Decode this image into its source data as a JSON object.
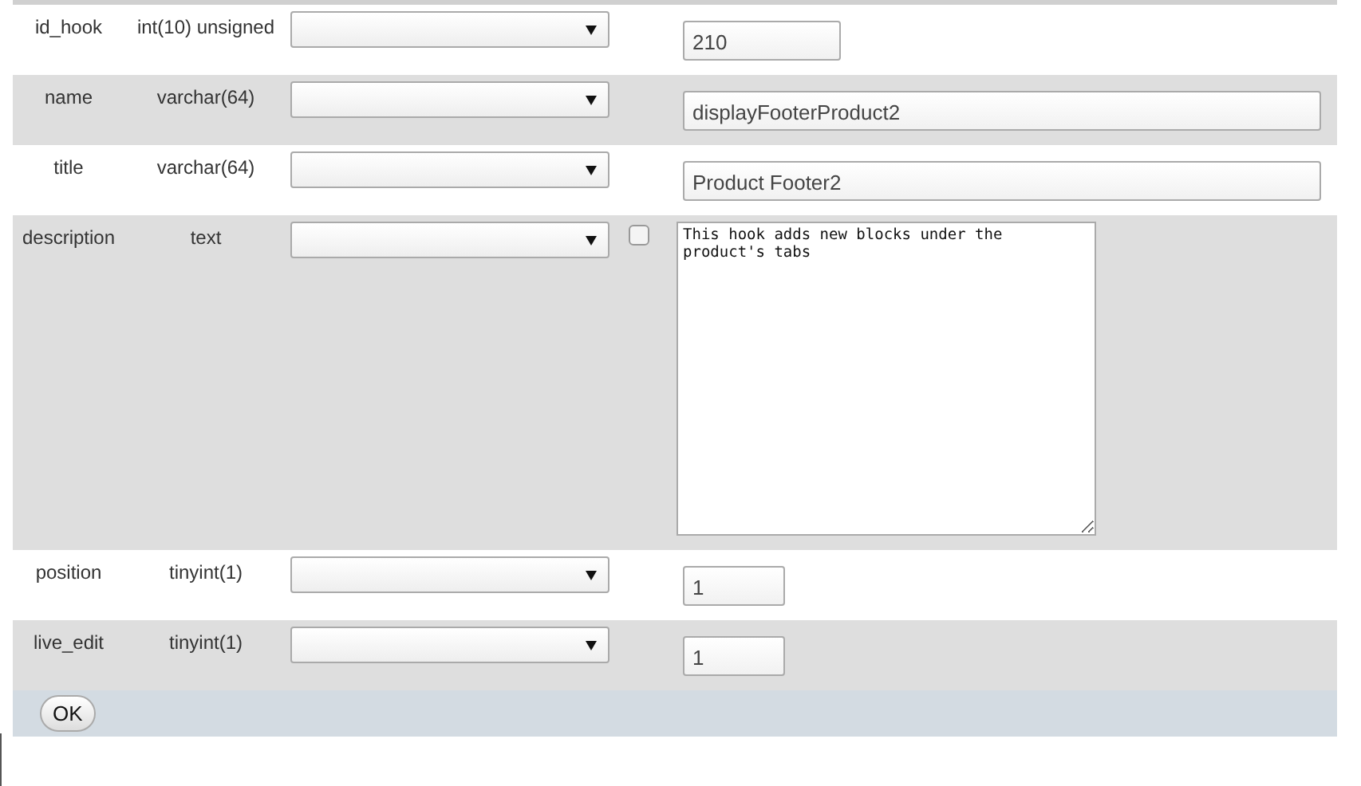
{
  "rows": [
    {
      "field": "id_hook",
      "type": "int(10) unsigned",
      "kind": "short",
      "value": "210"
    },
    {
      "field": "name",
      "type": "varchar(64)",
      "kind": "wide",
      "value": "displayFooterProduct2"
    },
    {
      "field": "title",
      "type": "varchar(64)",
      "kind": "wide",
      "value": "Product Footer2"
    },
    {
      "field": "description",
      "type": "text",
      "kind": "textarea",
      "value": "This hook adds new blocks under the product's tabs",
      "null_checkbox": {
        "checked": false
      }
    },
    {
      "field": "position",
      "type": "tinyint(1)",
      "kind": "tiny",
      "value": "1"
    },
    {
      "field": "live_edit",
      "type": "tinyint(1)",
      "kind": "tiny",
      "value": "1"
    }
  ],
  "submit_button": "OK"
}
